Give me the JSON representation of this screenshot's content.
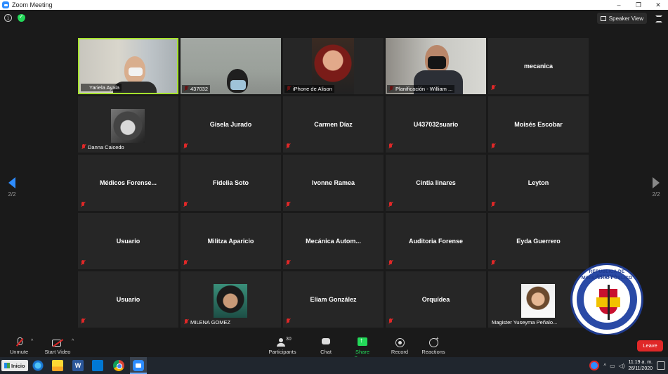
{
  "window": {
    "title": "Zoom Meeting",
    "controls": [
      "–",
      "❐",
      "✕"
    ]
  },
  "topbar": {
    "view_label": "Speaker View"
  },
  "pagination": {
    "left": "2/2",
    "right": "2/2"
  },
  "colors": {
    "accent": "#2d8cff",
    "active_speaker": "#a6e22e",
    "muted": "#e02828",
    "share": "#23d959",
    "leave": "#e02828"
  },
  "participants": [
    {
      "name": "Yariela Ayala",
      "video": true
    },
    {
      "name": "437032",
      "video": true
    },
    {
      "name": "iPhone de Alison",
      "video": true
    },
    {
      "name": "Planificación - William ...",
      "video": true
    },
    {
      "name": "mecanica",
      "video": false
    },
    {
      "name": "Danna Caicedo",
      "video": false,
      "photo": true
    },
    {
      "name": "Gisela Jurado",
      "video": false
    },
    {
      "name": "Carmen Díaz",
      "video": false
    },
    {
      "name": "U437032suario",
      "video": false
    },
    {
      "name": "Moisés Escobar",
      "video": false
    },
    {
      "name": "Médicos  Forense...",
      "video": false
    },
    {
      "name": "Fidelia Soto",
      "video": false
    },
    {
      "name": "Ivonne Ramea",
      "video": false
    },
    {
      "name": "Cintia linares",
      "video": false
    },
    {
      "name": "Leyton",
      "video": false
    },
    {
      "name": "Usuario",
      "video": false
    },
    {
      "name": "Militza Aparicio",
      "video": false
    },
    {
      "name": "Mecánica  Autom...",
      "video": false
    },
    {
      "name": "Auditoria Forense",
      "video": false
    },
    {
      "name": "Eyda Guerrero",
      "video": false
    },
    {
      "name": "Usuario",
      "video": false
    },
    {
      "name": "MILENA GOMEZ",
      "video": false,
      "photo": true
    },
    {
      "name": "Eliam González",
      "video": false
    },
    {
      "name": "Orquídea",
      "video": false
    },
    {
      "name": "Magister Yuseyma Peñalo...",
      "video": false,
      "photo": true
    }
  ],
  "seal": {
    "line1": "REPÚBLICA DE PANAMÁ",
    "line2": "MINISTERIO PÚBLICO"
  },
  "toolbar": {
    "unmute": "Unmute",
    "start_video": "Start Video",
    "participants": "Participants",
    "participants_count": "30",
    "chat": "Chat",
    "share_screen": "Share Screen",
    "record": "Record",
    "reactions": "Reactions",
    "leave": "Leave",
    "caret": "^"
  },
  "taskbar": {
    "start": "Inicio",
    "word_letter": "W",
    "tray_chevron": "^",
    "time": "11:19 a. m.",
    "date": "26/11/2020"
  }
}
